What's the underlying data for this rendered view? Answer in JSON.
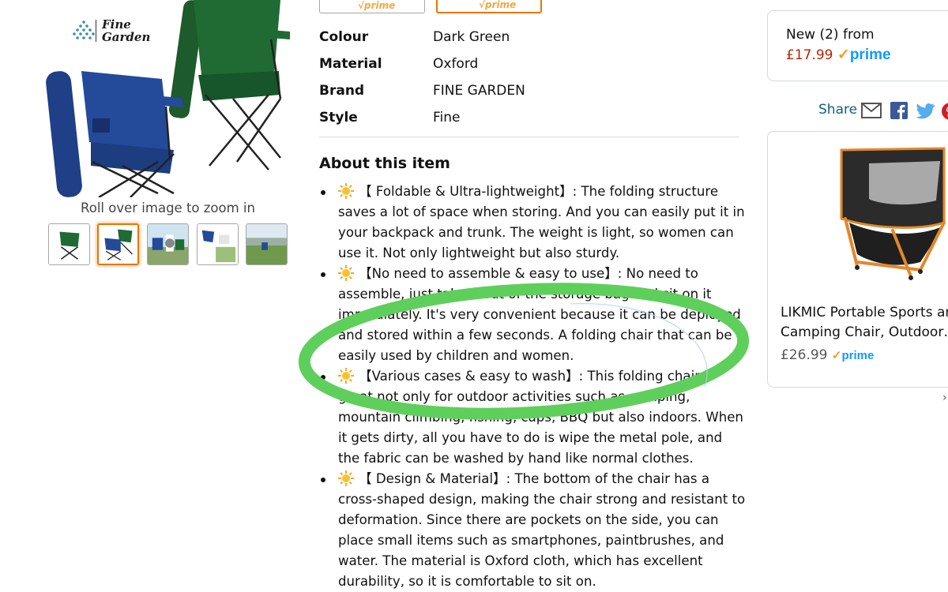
{
  "brand_logo": {
    "line1": "Fine",
    "line2": "Garden"
  },
  "gallery": {
    "zoom_hint": "Roll over image to zoom in",
    "thumbnails": [
      "thumb-green-chair",
      "thumb-blue-green-chairs",
      "thumb-camping-scene",
      "thumb-chairs-and-scene",
      "thumb-outdoor-lake"
    ],
    "selected_index": 1
  },
  "variations": {
    "button1_tail": "√prime",
    "button2_tail": "√prime"
  },
  "specs": [
    {
      "label": "Colour",
      "value": "Dark Green"
    },
    {
      "label": "Material",
      "value": "Oxford"
    },
    {
      "label": "Brand",
      "value": "FINE GARDEN"
    },
    {
      "label": "Style",
      "value": "Fine"
    }
  ],
  "about": {
    "title": "About this item",
    "bullets": [
      "【 Foldable & Ultra-lightweight】: The folding structure saves a lot of space when storing. And you can easily put it in your backpack and trunk. The weight is light, so women can use it. Not only lightweight but also sturdy.",
      "【No need to assemble & easy to use】: No need to assemble, just take it out of the storage bag and sit on it immediately. It's very convenient because it can be deployed and stored within a few seconds. A folding chair that can be easily used by children and women.",
      "【Various cases & easy to wash】: This folding chair is great not only for outdoor activities such as camping, mountain climbing, fishing, caps, BBQ but also indoors. When it gets dirty, all you have to do is wipe the metal pole, and the fabric can be washed by hand like normal clothes.",
      "【 Design & Material】: The bottom of the chair has a cross-shaped design, making the chair strong and resistant to deformation. Since there are pockets on the side, you can place small items such as smartphones, paintbrushes, and water. The material is Oxford cloth, which has excellent durability, so it is comfortable to sit on."
    ]
  },
  "annotation": {
    "color": "#5fcf5c"
  },
  "offer": {
    "label": "New (2) from",
    "price": "£17.99",
    "prime_check": "✓",
    "prime_word": "prime"
  },
  "share": {
    "label": "Share"
  },
  "sponsored": {
    "title_line1": "LIKMIC Portable Sports ar",
    "title_line2": "Camping Chair, Outdoor…",
    "price": "£26.99",
    "prime_check": "✓",
    "prime_word": "prime"
  },
  "carousel": {
    "next_symbol": "›"
  },
  "colors": {
    "accent_orange": "#e77600",
    "price_red": "#b12704",
    "prime_blue": "#1399ff",
    "link_teal": "#0f5f80"
  }
}
